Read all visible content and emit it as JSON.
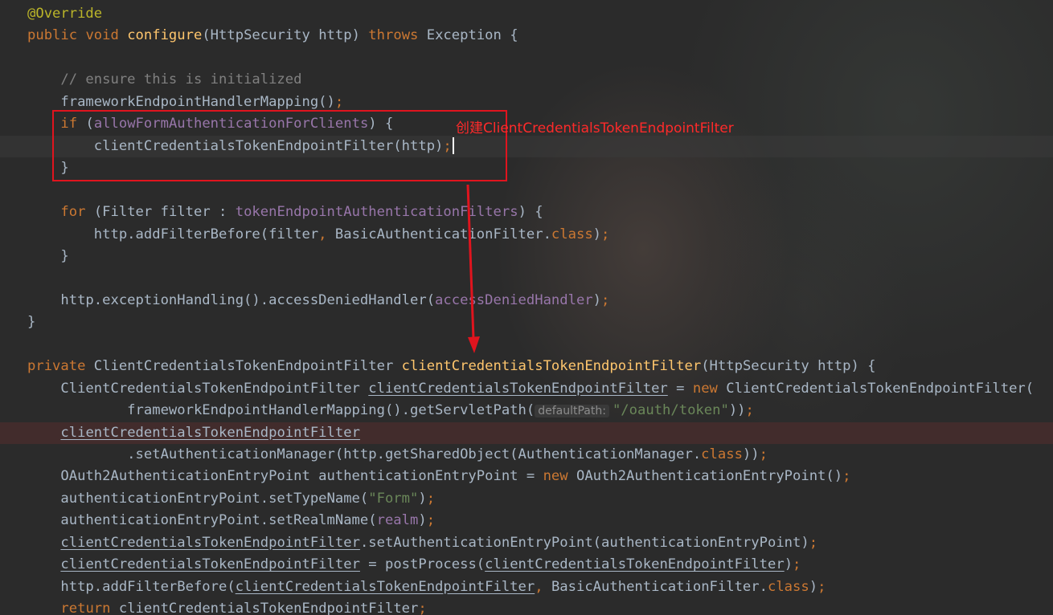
{
  "annotation": {
    "text": "创建ClientCredentialsTokenEndpointFilter",
    "color": "#e0141e"
  },
  "colors": {
    "background": "#2b2b2b",
    "keyword": "#cc7832",
    "annotation": "#bbb529",
    "method_decl": "#ffc66d",
    "field": "#9876aa",
    "string": "#6a8759",
    "comment": "#808080",
    "default_text": "#a9b7c6"
  },
  "editor": {
    "caret_line": 6,
    "error_line": 19,
    "lines": [
      {
        "tokens": [
          {
            "t": "@Override",
            "c": "an"
          }
        ]
      },
      {
        "tokens": [
          {
            "t": "public ",
            "c": "k"
          },
          {
            "t": "void ",
            "c": "k"
          },
          {
            "t": "configure",
            "c": "fn"
          },
          {
            "t": "(HttpSecurity http) "
          },
          {
            "t": "throws ",
            "c": "k"
          },
          {
            "t": "Exception {"
          }
        ]
      },
      {
        "tokens": []
      },
      {
        "tokens": [
          {
            "t": "    // ensure this is initialized",
            "c": "cm"
          }
        ]
      },
      {
        "tokens": [
          {
            "t": "    frameworkEndpointHandlerMapping()"
          },
          {
            "t": ";",
            "c": "k"
          }
        ]
      },
      {
        "tokens": [
          {
            "t": "    "
          },
          {
            "t": "if ",
            "c": "k"
          },
          {
            "t": "("
          },
          {
            "t": "allowFormAuthenticationForClients",
            "c": "fd"
          },
          {
            "t": ") {"
          }
        ]
      },
      {
        "tokens": [
          {
            "t": "        clientCredentialsTokenEndpointFilter(http)"
          },
          {
            "t": ";",
            "c": "k"
          },
          {
            "caret": true
          }
        ]
      },
      {
        "tokens": [
          {
            "t": "    }"
          }
        ]
      },
      {
        "tokens": []
      },
      {
        "tokens": [
          {
            "t": "    "
          },
          {
            "t": "for ",
            "c": "k"
          },
          {
            "t": "(Filter filter : "
          },
          {
            "t": "tokenEndpointAuthenticationFilters",
            "c": "fd"
          },
          {
            "t": ") {"
          }
        ]
      },
      {
        "tokens": [
          {
            "t": "        http.addFilterBefore(filter"
          },
          {
            "t": ", ",
            "c": "k"
          },
          {
            "t": "BasicAuthenticationFilter."
          },
          {
            "t": "class",
            "c": "k"
          },
          {
            "t": ")"
          },
          {
            "t": ";",
            "c": "k"
          }
        ]
      },
      {
        "tokens": [
          {
            "t": "    }"
          }
        ]
      },
      {
        "tokens": []
      },
      {
        "tokens": [
          {
            "t": "    http.exceptionHandling().accessDeniedHandler("
          },
          {
            "t": "accessDeniedHandler",
            "c": "fd"
          },
          {
            "t": ")"
          },
          {
            "t": ";",
            "c": "k"
          }
        ]
      },
      {
        "tokens": [
          {
            "t": "}"
          }
        ]
      },
      {
        "tokens": []
      },
      {
        "tokens": [
          {
            "t": "private ",
            "c": "k"
          },
          {
            "t": "ClientCredentialsTokenEndpointFilter "
          },
          {
            "t": "clientCredentialsTokenEndpointFilter",
            "c": "fn"
          },
          {
            "t": "(HttpSecurity http) {"
          }
        ]
      },
      {
        "tokens": [
          {
            "t": "    ClientCredentialsTokenEndpointFilter "
          },
          {
            "t": "clientCredentialsTokenEndpointFilter",
            "c": "ul"
          },
          {
            "t": " = "
          },
          {
            "t": "new ",
            "c": "k"
          },
          {
            "t": "ClientCredentialsTokenEndpointFilter("
          }
        ]
      },
      {
        "tokens": [
          {
            "t": "            frameworkEndpointHandlerMapping().getServletPath("
          },
          {
            "hint": "defaultPath:"
          },
          {
            "t": "\"/oauth/token\"",
            "c": "st"
          },
          {
            "t": "))"
          },
          {
            "t": ";",
            "c": "k"
          }
        ]
      },
      {
        "tokens": [
          {
            "t": "    "
          },
          {
            "t": "clientCredentialsTokenEndpointFilter",
            "c": "ul"
          }
        ]
      },
      {
        "tokens": [
          {
            "t": "            .setAuthenticationManager(http.getSharedObject(AuthenticationManager."
          },
          {
            "t": "class",
            "c": "k"
          },
          {
            "t": "))"
          },
          {
            "t": ";",
            "c": "k"
          }
        ]
      },
      {
        "tokens": [
          {
            "t": "    OAuth2AuthenticationEntryPoint authenticationEntryPoint = "
          },
          {
            "t": "new ",
            "c": "k"
          },
          {
            "t": "OAuth2AuthenticationEntryPoint()"
          },
          {
            "t": ";",
            "c": "k"
          }
        ]
      },
      {
        "tokens": [
          {
            "t": "    authenticationEntryPoint.setTypeName("
          },
          {
            "t": "\"Form\"",
            "c": "st"
          },
          {
            "t": ")"
          },
          {
            "t": ";",
            "c": "k"
          }
        ]
      },
      {
        "tokens": [
          {
            "t": "    authenticationEntryPoint.setRealmName("
          },
          {
            "t": "realm",
            "c": "fd"
          },
          {
            "t": ")"
          },
          {
            "t": ";",
            "c": "k"
          }
        ]
      },
      {
        "tokens": [
          {
            "t": "    "
          },
          {
            "t": "clientCredentialsTokenEndpointFilter",
            "c": "ul"
          },
          {
            "t": ".setAuthenticationEntryPoint(authenticationEntryPoint)"
          },
          {
            "t": ";",
            "c": "k"
          }
        ]
      },
      {
        "tokens": [
          {
            "t": "    "
          },
          {
            "t": "clientCredentialsTokenEndpointFilter",
            "c": "ul"
          },
          {
            "t": " = postProcess("
          },
          {
            "t": "clientCredentialsTokenEndpointFilter",
            "c": "ul"
          },
          {
            "t": ")"
          },
          {
            "t": ";",
            "c": "k"
          }
        ]
      },
      {
        "tokens": [
          {
            "t": "    http.addFilterBefore("
          },
          {
            "t": "clientCredentialsTokenEndpointFilter",
            "c": "ul"
          },
          {
            "t": ", ",
            "c": "k"
          },
          {
            "t": "BasicAuthenticationFilter."
          },
          {
            "t": "class",
            "c": "k"
          },
          {
            "t": ")"
          },
          {
            "t": ";",
            "c": "k"
          }
        ]
      },
      {
        "tokens": [
          {
            "t": "    "
          },
          {
            "t": "return ",
            "c": "k"
          },
          {
            "t": "clientCredentialsTokenEndpointFilter",
            "c": "ul"
          },
          {
            "t": ";",
            "c": "k"
          }
        ]
      }
    ]
  }
}
